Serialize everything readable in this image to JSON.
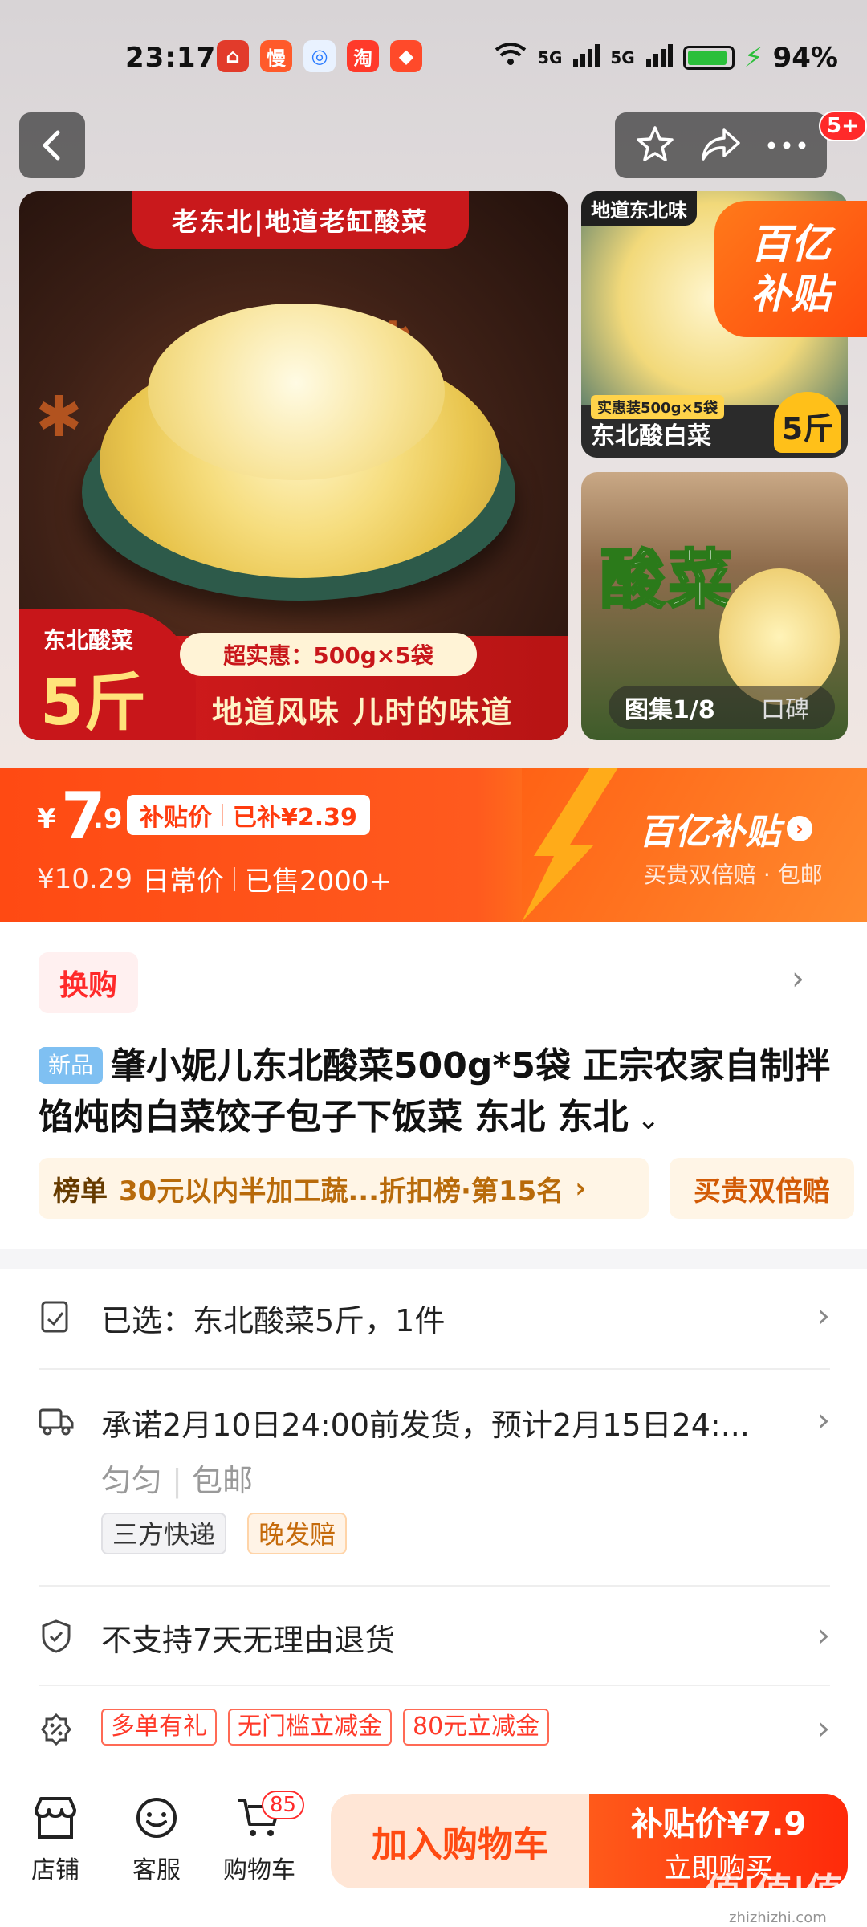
{
  "status_bar": {
    "time": "23:17",
    "battery": "94%",
    "signal1": "5G",
    "signal2": "5G"
  },
  "header": {
    "badge": "5+"
  },
  "gallery": {
    "main_banner": "老东北|地道老缸酸菜",
    "main_badge_label": "东北酸菜",
    "main_badge_weight": "5斤",
    "main_spec": "超实惠：500g×5袋",
    "main_slogan": "地道风味 儿时的味道",
    "thumb1_tag": "地道东北味",
    "thumb1_spec": "实惠装500g×5袋",
    "thumb1_name": "东北酸白菜",
    "thumb1_weight": "5斤",
    "subsidy_line1": "百亿",
    "subsidy_line2": "补贴",
    "thumb2_title": "酸菜",
    "counter": "图集1/8",
    "reviews": "口碑"
  },
  "price": {
    "currency": "¥",
    "int": "7",
    "dec": ".9",
    "tag_label": "补贴价",
    "tag_saved": "已补¥2.39",
    "regular": "¥10.29",
    "regular_label": "日常价",
    "sold": "已售2000+",
    "brand": "百亿补贴",
    "brand_sub": "买贵双倍赔 · 包邮"
  },
  "swap_label": "换购",
  "product": {
    "new_tag": "新品",
    "title": "肇小妮儿东北酸菜500g*5袋 正宗农家自制拌馅炖肉白菜饺子包子下饭菜 东北 东北"
  },
  "rank": {
    "label": "榜单",
    "text": "30元以内半加工蔬...折扣榜·第15名",
    "double_pay": "买贵双倍赔"
  },
  "rows": {
    "selected": "已选：东北酸菜5斤，1件",
    "shipping": "承诺2月10日24:00前发货，预计2月15日24:...",
    "origin": "匀匀",
    "free_ship": "包邮",
    "chip1": "三方快递",
    "chip2": "晚发赔",
    "returns": "不支持7天无理由退货",
    "coupon1": "多单有礼",
    "coupon2": "无门槛立减金",
    "coupon3": "80元立减金"
  },
  "bottom": {
    "shop": "店铺",
    "service": "客服",
    "cart": "购物车",
    "cart_count": "85",
    "add_cart": "加入购物车",
    "buy_price": "补贴价¥7.9",
    "buy_now": "立即购买"
  },
  "watermark": {
    "main": "值|值|值",
    "url": "zhizhizhi.com"
  }
}
